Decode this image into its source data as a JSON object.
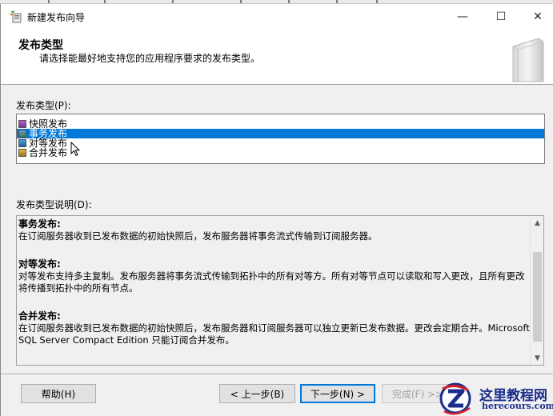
{
  "window": {
    "title": "新建发布向导",
    "controls": {
      "minimize": "—",
      "maximize": "☐",
      "close": "✕"
    }
  },
  "header": {
    "title": "发布类型",
    "subtitle": "请选择能最好地支持您的应用程序要求的发布类型。"
  },
  "publication_types": {
    "label": "发布类型(P):",
    "selected_index": 1,
    "items": [
      {
        "label": "快照发布",
        "icon": "snapshot-publication-icon"
      },
      {
        "label": "事务发布",
        "icon": "transactional-publication-icon"
      },
      {
        "label": "对等发布",
        "icon": "peer-to-peer-publication-icon"
      },
      {
        "label": "合并发布",
        "icon": "merge-publication-icon"
      }
    ]
  },
  "description": {
    "label": "发布类型说明(D):",
    "sections": [
      {
        "title": "事务发布:",
        "body": "在订阅服务器收到已发布数据的初始快照后，发布服务器将事务流式传输到订阅服务器。"
      },
      {
        "title": "对等发布:",
        "body": "对等发布支持多主复制。发布服务器将事务流式传输到拓扑中的所有对等方。所有对等节点可以读取和写入更改，且所有更改将传播到拓扑中的所有节点。"
      },
      {
        "title": "合并发布:",
        "body": "在订阅服务器收到已发布数据的初始快照后，发布服务器和订阅服务器可以独立更新已发布数据。更改会定期合并。Microsoft SQL Server Compact Edition 只能订阅合并发布。"
      }
    ]
  },
  "buttons": {
    "help": "帮助(H)",
    "back": "< 上一步(B)",
    "next": "下一步(N) >",
    "finish": "完成(F) >>|"
  },
  "watermark": {
    "title": "这里教程网",
    "url": "herecours.com"
  },
  "colors": {
    "selection": "#0078d7",
    "dialog_bg": "#f0f0f0",
    "watermark": "#1a2d8a",
    "watermark_accent": "#d0202a"
  }
}
